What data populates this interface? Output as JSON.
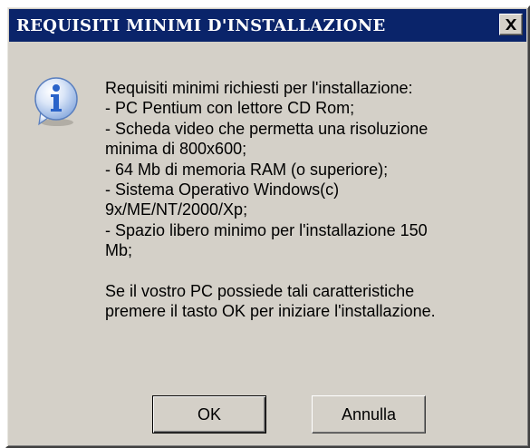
{
  "dialog": {
    "title": "REQUISITI MINIMI D'INSTALLAZIONE",
    "close_symbol": "✕",
    "icon": "info-icon",
    "message_lines": [
      "Requisiti minimi richiesti per l'installazione:",
      "- PC Pentium con lettore CD Rom;",
      "- Scheda video che permetta una risoluzione",
      "minima di 800x600;",
      "- 64 Mb di memoria RAM (o superiore);",
      "- Sistema Operativo Windows(c)",
      "9x/ME/NT/2000/Xp;",
      "- Spazio libero minimo per l'installazione 150",
      "Mb;",
      "",
      "Se il vostro PC possiede tali caratteristiche",
      "premere il tasto OK per iniziare l'installazione."
    ],
    "ok_label": "OK",
    "cancel_label": "Annulla"
  },
  "colors": {
    "titlebar": "#0a246a",
    "face": "#d4d0c8",
    "icon_blue": "#2a63c9"
  }
}
